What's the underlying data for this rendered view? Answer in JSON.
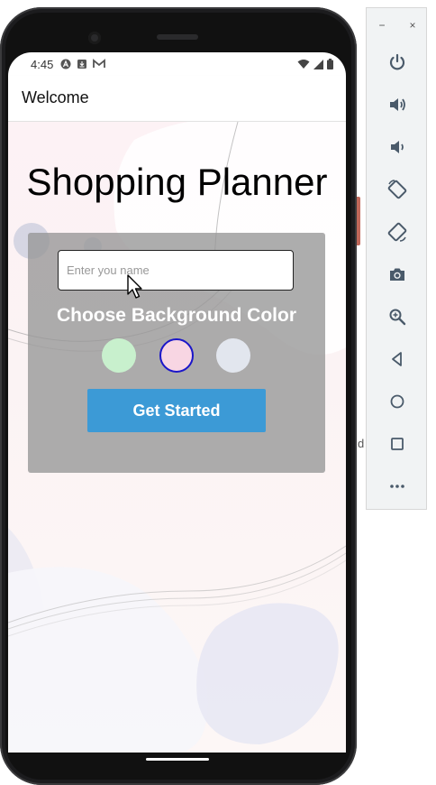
{
  "status_bar": {
    "time": "4:45",
    "icons": [
      "a-icon",
      "download-icon",
      "gmail-icon"
    ],
    "right_icons": [
      "wifi-icon",
      "signal-icon",
      "battery-icon"
    ]
  },
  "header": {
    "title": "Welcome"
  },
  "main": {
    "title": "Shopping Planner",
    "name_input": {
      "value": "",
      "placeholder": "Enter you name"
    },
    "choose_label": "Choose Background Color",
    "colors": [
      {
        "name": "green",
        "hex": "#c8f0cd",
        "selected": false
      },
      {
        "name": "pink",
        "hex": "#f8d6e3",
        "selected": true
      },
      {
        "name": "grey",
        "hex": "#e2e6ee",
        "selected": false
      }
    ],
    "selected_border_color": "#1b16c9",
    "button_label": "Get Started",
    "button_color": "#3c9ad6"
  },
  "emulator_toolbar": {
    "window_controls": [
      "−",
      "×"
    ],
    "tools": [
      "power-icon",
      "volume-up-icon",
      "volume-down-icon",
      "rotate-left-icon",
      "rotate-right-icon",
      "camera-icon",
      "zoom-icon",
      "back-icon",
      "home-icon",
      "overview-icon",
      "more-icon"
    ]
  },
  "stray_text": "d"
}
